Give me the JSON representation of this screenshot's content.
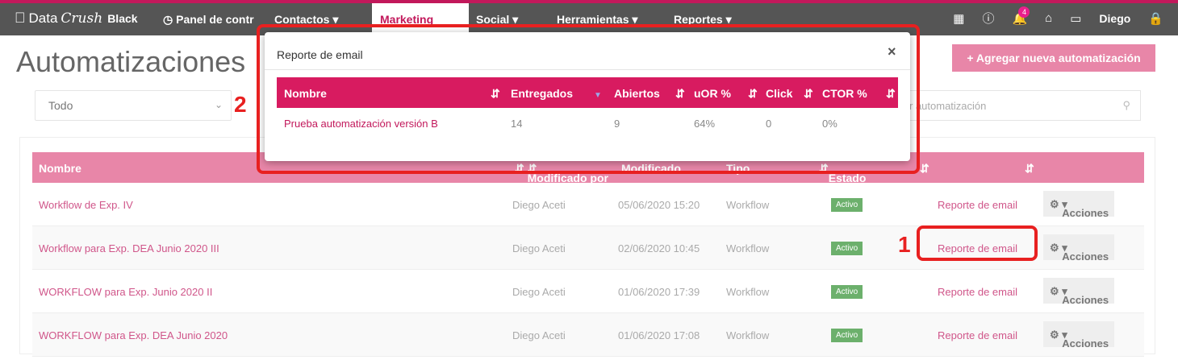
{
  "nav": {
    "brand_data": "Data",
    "brand_crush": "Crush",
    "brand_black": "Black",
    "items": [
      "Panel de contr",
      "Contactos ▾",
      "Marketing",
      "Social ▾",
      "Herramientas ▾",
      "Reportes ▾"
    ],
    "notification_count": "4",
    "user": "Diego"
  },
  "page": {
    "title": "Automatizaciones",
    "add_button": "+ Agregar nueva automatización",
    "filter_value": "Todo",
    "search_placeholder": "r automatización"
  },
  "table": {
    "headers": [
      "Nombre",
      "Modificado por",
      "Modificado",
      "Tipo",
      "Estado"
    ],
    "rows": [
      {
        "name": "Workflow de Exp. IV",
        "by": "Diego Aceti",
        "date": "05/06/2020 15:20",
        "type": "Workflow",
        "status": "Activo",
        "report": "Reporte de email",
        "actions": "Acciones"
      },
      {
        "name": "Workflow para Exp. DEA Junio 2020 III",
        "by": "Diego Aceti",
        "date": "02/06/2020 10:45",
        "type": "Workflow",
        "status": "Activo",
        "report": "Reporte de email",
        "actions": "Acciones"
      },
      {
        "name": "WORKFLOW para Exp. Junio 2020 II",
        "by": "Diego Aceti",
        "date": "01/06/2020 17:39",
        "type": "Workflow",
        "status": "Activo",
        "report": "Reporte de email",
        "actions": "Acciones"
      },
      {
        "name": "WORKFLOW para Exp. DEA Junio 2020",
        "by": "Diego Aceti",
        "date": "01/06/2020 17:08",
        "type": "Workflow",
        "status": "Activo",
        "report": "Reporte de email",
        "actions": "Acciones"
      }
    ]
  },
  "modal": {
    "title": "Reporte de email",
    "close": "×",
    "headers": [
      "Nombre",
      "Entregados",
      "Abiertos",
      "uOR %",
      "Click",
      "CTOR %"
    ],
    "row": {
      "name": "Prueba automatización versión B",
      "delivered": "14",
      "opened": "9",
      "uor": "64%",
      "click": "0",
      "ctor": "0%"
    }
  },
  "annotations": {
    "one": "1",
    "two": "2"
  },
  "colors": {
    "accent": "#c2185b",
    "header_pink": "#e886a8",
    "modal_header": "#d81b60",
    "highlight": "#e82020",
    "active_green": "#6cb06c"
  }
}
